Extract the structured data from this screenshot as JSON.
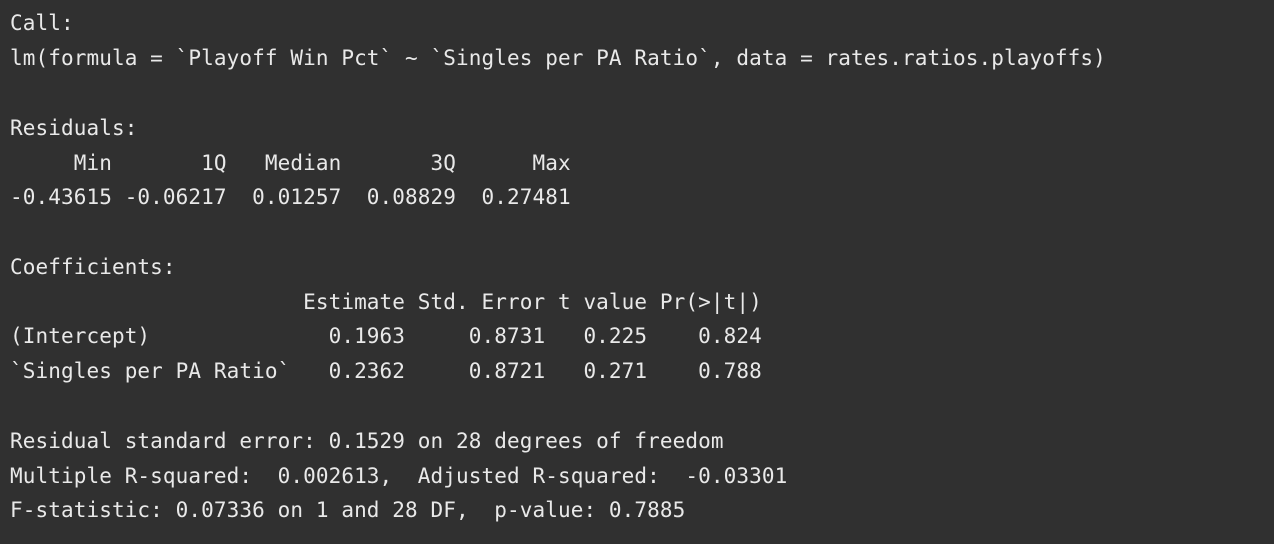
{
  "console": {
    "background": "#303030",
    "text_color": "#e9e9e9",
    "lines": [
      "Call:",
      "lm(formula = `Playoff Win Pct` ~ `Singles per PA Ratio`, data = rates.ratios.playoffs)",
      "Residuals:",
      "     Min       1Q   Median       3Q      Max ",
      "-0.43615 -0.06217  0.01257  0.08829  0.27481 ",
      "Coefficients:",
      "                       Estimate Std. Error t value Pr(>|t|)",
      "(Intercept)              0.1963     0.8731   0.225    0.824",
      "`Singles per PA Ratio`   0.2362     0.8721   0.271    0.788",
      "Residual standard error: 0.1529 on 28 degrees of freedom",
      "Multiple R-squared:  0.002613,\tAdjusted R-squared:  -0.03301 ",
      "F-statistic: 0.07336 on 1 and 28 DF,  p-value: 0.7885"
    ]
  }
}
